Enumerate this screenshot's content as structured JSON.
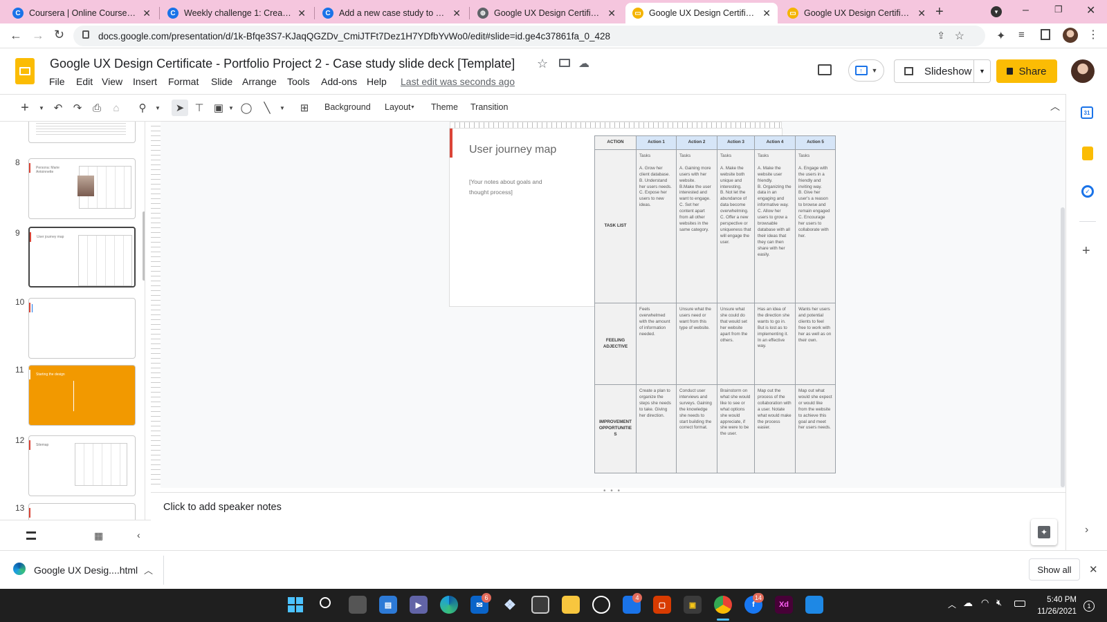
{
  "browser": {
    "tabs": [
      {
        "title": "Coursera | Online Courses & C",
        "icon": "coursera-icon",
        "color": "#1a73e8",
        "glyph": "C"
      },
      {
        "title": "Weekly challenge 1: Create a p",
        "icon": "coursera-icon",
        "color": "#1a73e8",
        "glyph": "C"
      },
      {
        "title": "Add a new case study to your",
        "icon": "coursera-icon",
        "color": "#1a73e8",
        "glyph": "C"
      },
      {
        "title": "Google UX Design Certificate",
        "icon": "globe-icon",
        "color": "#5f6368",
        "glyph": "⊕"
      },
      {
        "title": "Google UX Design Certificate",
        "icon": "slides-icon",
        "color": "#f4b400",
        "glyph": "▭",
        "active": true
      },
      {
        "title": "Google UX Design Certificate",
        "icon": "slides-icon",
        "color": "#f4b400",
        "glyph": "▭"
      }
    ],
    "url": "docs.google.com/presentation/d/1k-Bfqe3S7-KJaqQGZDv_CmiJTFt7Dez1H7YDfbYvWo0/edit#slide=id.ge4c37861fa_0_428"
  },
  "doc": {
    "title": "Google UX Design Certificate - Portfolio Project 2 - Case study slide deck [Template]",
    "menu": [
      "File",
      "Edit",
      "View",
      "Insert",
      "Format",
      "Slide",
      "Arrange",
      "Tools",
      "Add-ons",
      "Help"
    ],
    "last_edit": "Last edit was seconds ago",
    "slideshow_label": "Slideshow",
    "share_label": "Share"
  },
  "toolbar": {
    "background": "Background",
    "layout": "Layout",
    "theme": "Theme",
    "transition": "Transition"
  },
  "filmstrip": {
    "slides": [
      {
        "num": "8",
        "title": "Persona: Marie Antoinnette"
      },
      {
        "num": "9",
        "title": "User journey map",
        "selected": true
      },
      {
        "num": "10",
        "title": ""
      },
      {
        "num": "11",
        "title": "Starting the design"
      },
      {
        "num": "12",
        "title": "Sitemap"
      },
      {
        "num": "13",
        "title": ""
      }
    ]
  },
  "slide": {
    "title": "User journey map",
    "notes": "[Your notes about goals and thought process]",
    "table": {
      "corner": "ACTION",
      "columns": [
        "Action 1",
        "Action 2",
        "Action 3",
        "Action 4",
        "Action 5"
      ],
      "rows": [
        {
          "label": "TASK LIST",
          "cells": [
            "Tasks\n\nA. Grow her client database.\nB. Understand her users needs.\nC. Expose her users to new ideas.",
            "Tasks\n\nA. Gaining more users with her website.\nB.Make the user interested and want to engage.\nC. Set her content apart from all other websites in the same category.",
            "Tasks\n\nA. Make the website both unique and interesting.\nB. Not let the abundance of data become overwhelming.\nC. Offer a new perspective or uniqueness that will engage the user.",
            "Tasks\n\nA. Make the website user friendly.\nB. Organizing the data in an engaging and informative way.\nC. Allow her users to grow a browsable database with all their ideas that they can then share with her easily.",
            "Tasks\n\nA. Engage with the users in a friendly and inviting way.\nB. Give her user's a reason to browse and remain engaged\nC. Encourage her users to collaborate with her."
          ]
        },
        {
          "label": "FEELING ADJECTIVE",
          "cells": [
            "Feels overwhelmed with the amount of information needed.",
            "Unsure what the users need or want from this type of website.",
            "Unsure what she could do that would set her website apart from the others.",
            "Has an idea of the direction she wants to go in. But is lost as to implementing it. In an effective way.",
            "Wants her users and potential clients to feel free to work with her as well as on their own."
          ]
        },
        {
          "label": "IMPROVEMENT OPPORTUNITIES",
          "cells": [
            "Create a plan to organize the steps she needs to take. Giving her direction.",
            "Conduct user interviews and surveys. Gaining the knowledge she needs to start building the correct format.",
            "Brainstorm on what she would like to see or what options she would appreciate, if she were to be the user.",
            "Map out the process of the collaboration with a user. Notate what would make the process easier.",
            "Map out what would she expect or would like from the website to achieve this goal and meet her users needs."
          ]
        }
      ]
    }
  },
  "speaker_notes": {
    "placeholder": "Click to add speaker notes"
  },
  "download": {
    "filename": "Google UX Desig....html",
    "show_all": "Show all"
  },
  "taskbar": {
    "time": "5:40 PM",
    "date": "11/26/2021",
    "badges": {
      "mail": "6",
      "phone": "4",
      "facebook": "14"
    },
    "notification_count": "1"
  },
  "colors": {
    "accent_yellow": "#fbbc04",
    "tab_strip": "#f5c6de",
    "slide_red_bar": "#db4437",
    "table_header": "#d6e5f7",
    "orange_slide": "#f29900"
  }
}
